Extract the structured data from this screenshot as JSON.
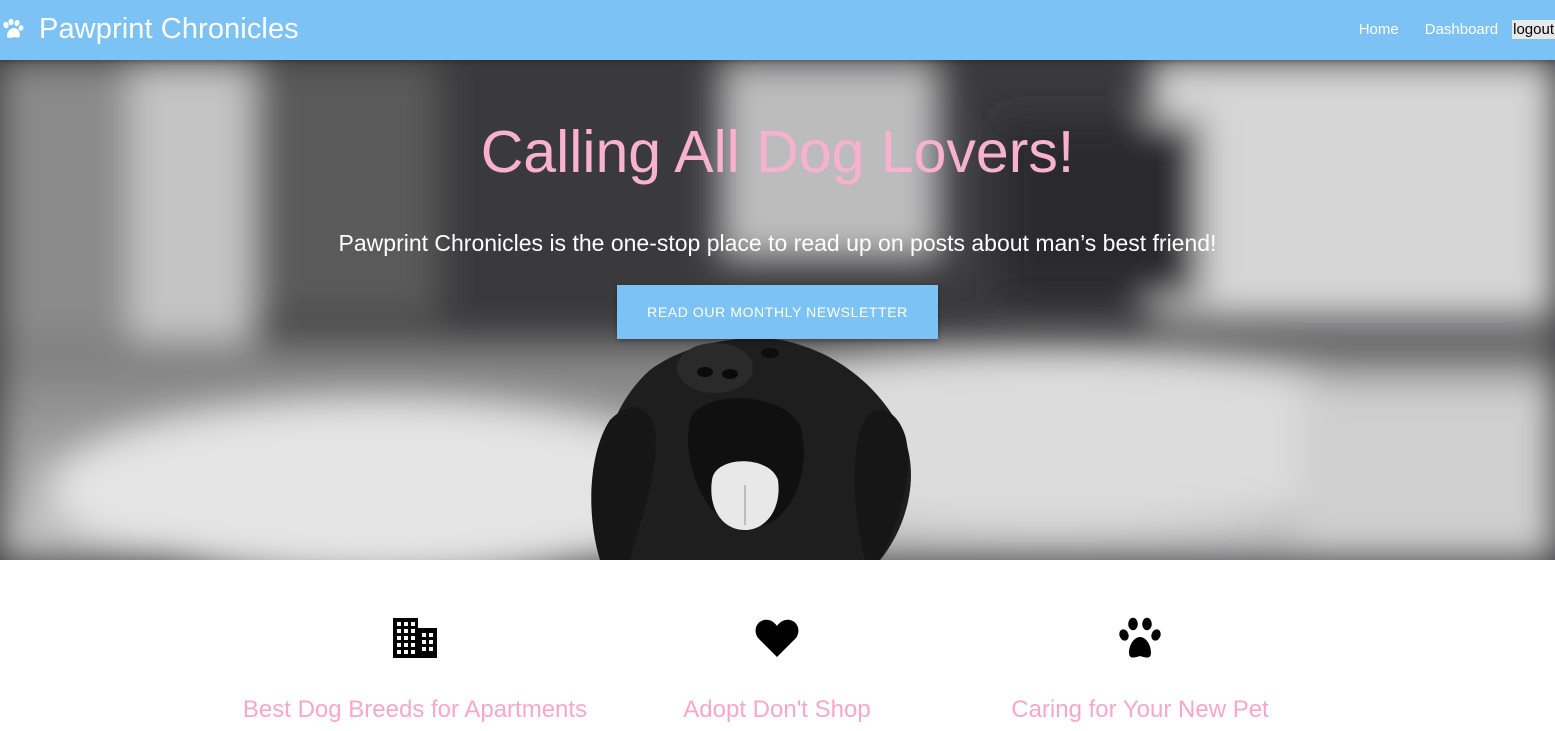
{
  "navbar": {
    "brand_title": "Pawprint Chronicles",
    "brand_icon": "paw-icon",
    "links": {
      "home": "Home",
      "dashboard": "Dashboard",
      "logout": "logout"
    },
    "background": "#7dc2f5"
  },
  "hero": {
    "title": "Calling All Dog Lovers!",
    "subtitle": "Pawprint Chronicles is the one-stop place to read up on posts about man’s best friend!",
    "button_label": "READ OUR MONTHLY NEWSLETTER",
    "title_color": "#f8b2cc"
  },
  "features": [
    {
      "icon": "building-icon",
      "title": "Best Dog Breeds for Apartments"
    },
    {
      "icon": "heart-icon",
      "title": "Adopt Don't Shop"
    },
    {
      "icon": "paw-icon",
      "title": "Caring for Your New Pet"
    }
  ]
}
